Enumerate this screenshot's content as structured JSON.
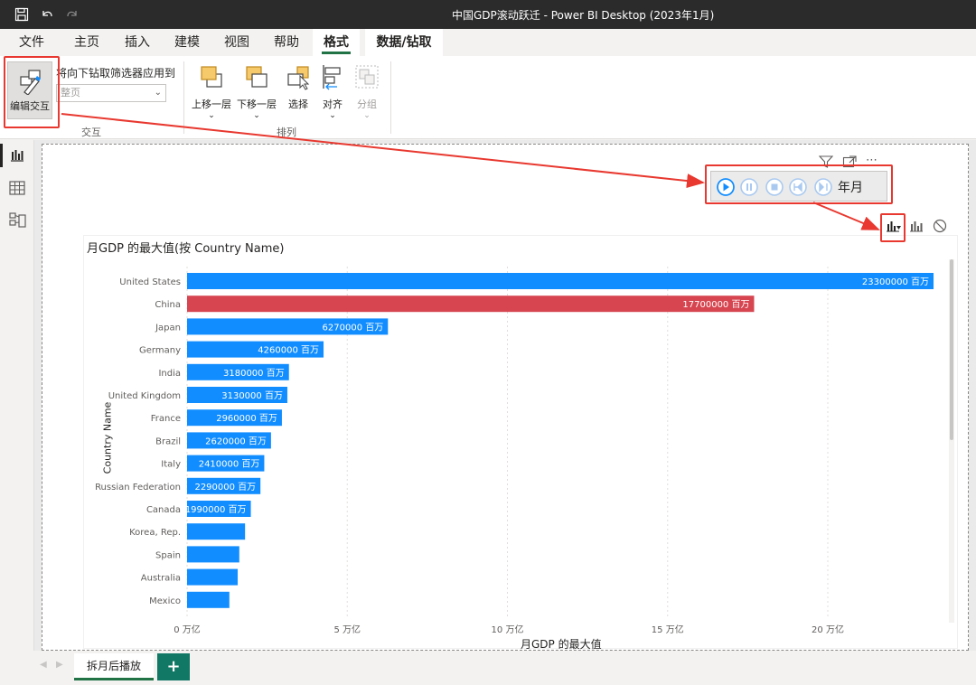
{
  "window": {
    "title": "中国GDP滚动跃迁 - Power BI Desktop (2023年1月)"
  },
  "menu": {
    "tabs": [
      "文件",
      "主页",
      "插入",
      "建模",
      "视图",
      "帮助",
      "格式",
      "数据/钻取"
    ],
    "active": "格式"
  },
  "ribbon": {
    "edit_interactions_label": "编辑交互",
    "drill_filter_label": "将向下钻取筛选器应用到",
    "drill_filter_placeholder": "整页",
    "interaction_group_label": "交互",
    "arrange_group_label": "排列",
    "bring_forward": "上移一层",
    "send_backward": "下移一层",
    "selection": "选择",
    "align": "对齐",
    "group": "分组"
  },
  "play_axis": {
    "label": "年月"
  },
  "chart": {
    "title": "月GDP 的最大值(按 Country Name)",
    "y_axis_title": "Country Name",
    "x_axis_title": "月GDP 的最大值",
    "x_ticks": [
      "0 万亿",
      "5 万亿",
      "10 万亿",
      "15 万亿",
      "20 万亿"
    ]
  },
  "chart_data": {
    "type": "bar",
    "orientation": "horizontal",
    "title": "月GDP 的最大值(按 Country Name)",
    "xlabel": "月GDP 的最大值",
    "ylabel": "Country Name",
    "unit": "百万",
    "xlim": [
      0,
      23300000
    ],
    "categories": [
      "United States",
      "China",
      "Japan",
      "Germany",
      "India",
      "United Kingdom",
      "France",
      "Brazil",
      "Italy",
      "Russian Federation",
      "Canada",
      "Korea, Rep.",
      "Spain",
      "Australia",
      "Mexico"
    ],
    "values": [
      23300000,
      17700000,
      6270000,
      4260000,
      3180000,
      3130000,
      2960000,
      2620000,
      2410000,
      2290000,
      1990000,
      1810000,
      1630000,
      1580000,
      1320000
    ],
    "labels": [
      "23300000 百万",
      "17700000 百万",
      "6270000 百万",
      "4260000 百万",
      "3180000 百万",
      "3130000 百万",
      "2960000 百万",
      "2620000 百万",
      "2410000 百万",
      "2290000 百万",
      "1990000 百万 ",
      "",
      "",
      "",
      ""
    ],
    "colors": {
      "default": "#118dff",
      "highlight": "#d64550"
    },
    "highlight_category": "China"
  },
  "sheet_tabs": {
    "active": "拆月后播放",
    "add": "+"
  }
}
